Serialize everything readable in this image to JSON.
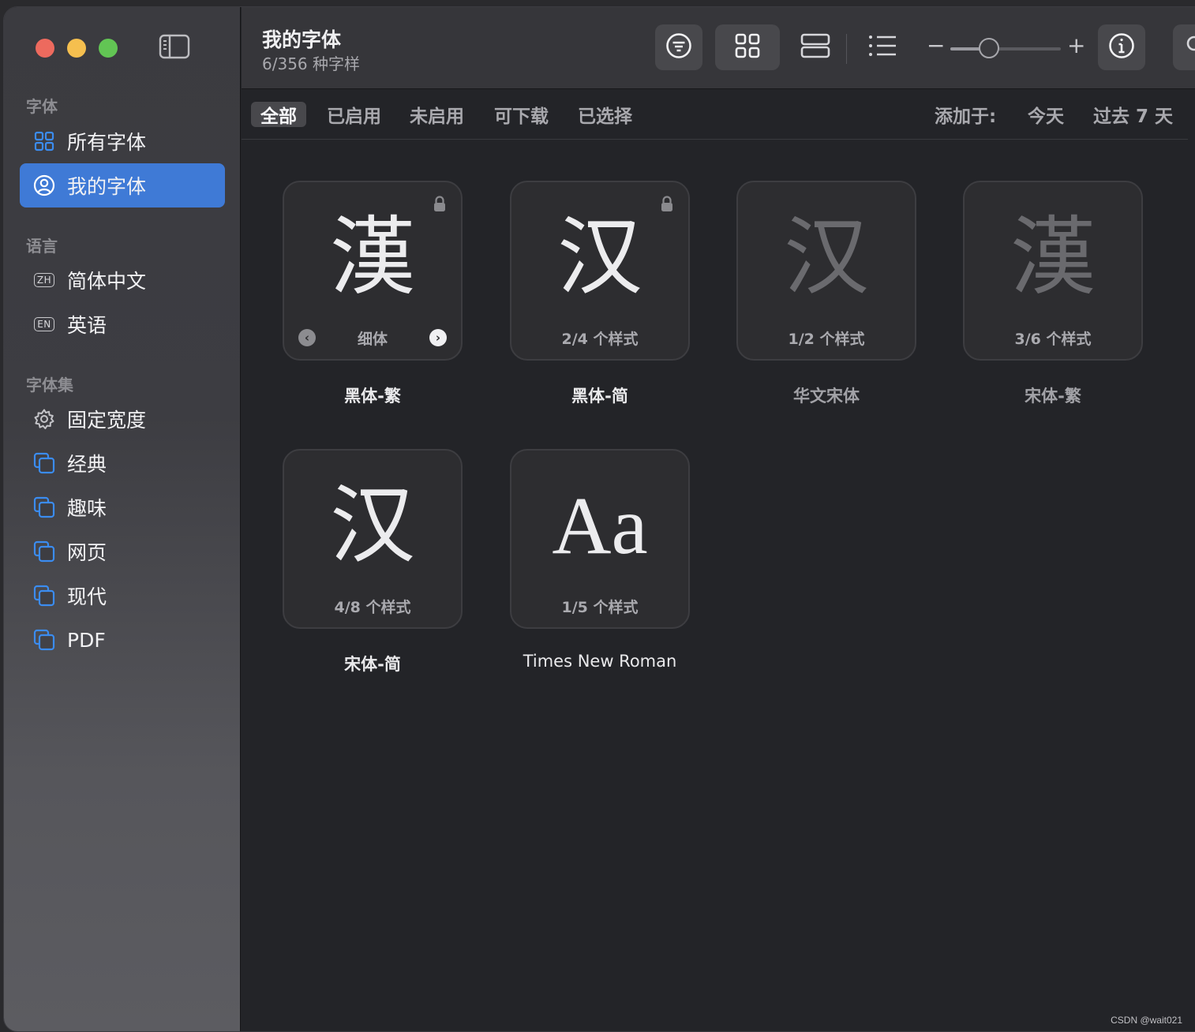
{
  "window": {
    "title": "我的字体",
    "subtitle": "6/356 种字样"
  },
  "sidebar": {
    "section_fonts": "字体",
    "section_languages": "语言",
    "section_collections": "字体集",
    "fonts": [
      {
        "label": "所有字体",
        "icon": "grid-icon",
        "active": false
      },
      {
        "label": "我的字体",
        "icon": "person-circle-icon",
        "active": true
      }
    ],
    "languages": [
      {
        "badge": "ZH",
        "label": "简体中文"
      },
      {
        "badge": "EN",
        "label": "英语"
      }
    ],
    "collections": [
      {
        "label": "固定宽度",
        "icon": "gear-icon"
      },
      {
        "label": "经典",
        "icon": "collection-icon"
      },
      {
        "label": "趣味",
        "icon": "collection-icon"
      },
      {
        "label": "网页",
        "icon": "collection-icon"
      },
      {
        "label": "现代",
        "icon": "collection-icon"
      },
      {
        "label": "PDF",
        "icon": "collection-icon"
      }
    ]
  },
  "toolbar": {
    "icons": [
      "filter-icon",
      "grid-view-icon",
      "rows-view-icon",
      "list-view-icon",
      "info-icon",
      "search-icon"
    ],
    "zoom_level": 0.35,
    "minus": "−",
    "plus": "+"
  },
  "filters": {
    "tabs": [
      "全部",
      "已启用",
      "未启用",
      "可下载",
      "已选择"
    ],
    "active_tab": "全部",
    "added_label": "添加于:",
    "date_options": [
      "今天",
      "过去 7 天"
    ]
  },
  "fonts": [
    {
      "glyph": "漢",
      "caption": "细体",
      "name": "黑体-繁",
      "locked": true,
      "dim": false,
      "has_nav": true
    },
    {
      "glyph": "汉",
      "caption": "2/4 个样式",
      "name": "黑体-简",
      "locked": true,
      "dim": false,
      "has_nav": false
    },
    {
      "glyph": "汉",
      "caption": "1/2 个样式",
      "name": "华文宋体",
      "locked": false,
      "dim": true,
      "has_nav": false
    },
    {
      "glyph": "漢",
      "caption": "3/6 个样式",
      "name": "宋体-繁",
      "locked": false,
      "dim": true,
      "has_nav": false
    },
    {
      "glyph": "汉",
      "caption": "4/8 个样式",
      "name": "宋体-简",
      "locked": false,
      "dim": false,
      "has_nav": false
    },
    {
      "glyph": "Aa",
      "caption": "1/5 个样式",
      "name": "Times New Roman",
      "locked": false,
      "dim": false,
      "has_nav": false
    }
  ],
  "watermark": "CSDN @wait021",
  "colors": {
    "accent": "#3f7ad6",
    "icon_blue": "#3b8cf0"
  }
}
